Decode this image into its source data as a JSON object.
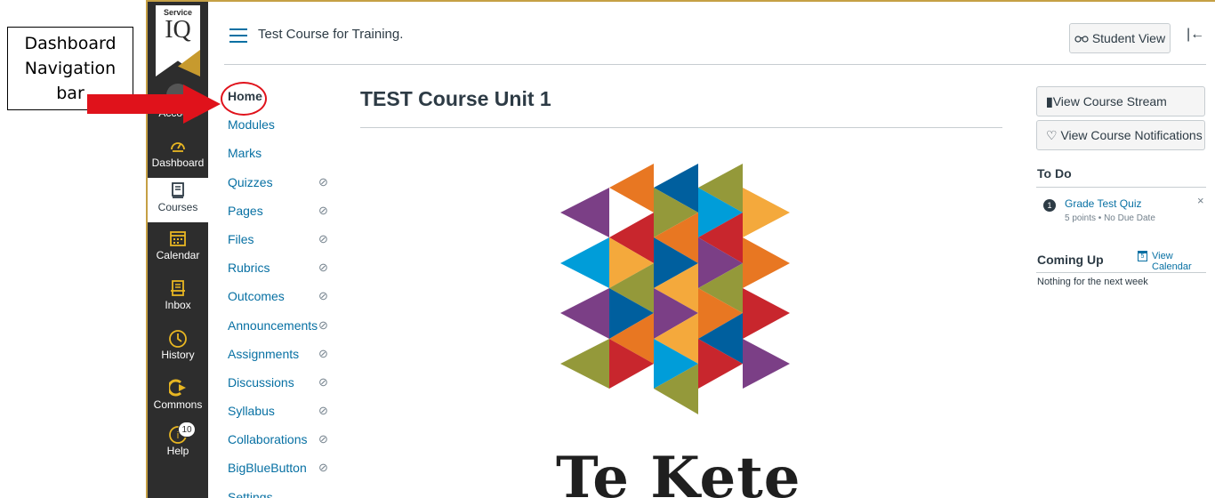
{
  "annotation": {
    "lines": [
      "Dashboard",
      "Navigation",
      "bar"
    ]
  },
  "global_nav": {
    "logo_top": "Service",
    "logo_main": "IQ",
    "items": [
      {
        "label": "Account",
        "icon": "account-avatar"
      },
      {
        "label": "Dashboard",
        "icon": "dashboard-icon"
      },
      {
        "label": "Courses",
        "icon": "courses-icon"
      },
      {
        "label": "Calendar",
        "icon": "calendar-icon"
      },
      {
        "label": "Inbox",
        "icon": "inbox-icon"
      },
      {
        "label": "History",
        "icon": "history-icon"
      },
      {
        "label": "Commons",
        "icon": "commons-icon"
      },
      {
        "label": "Help",
        "icon": "help-icon",
        "badge": "10"
      }
    ],
    "active": "Courses"
  },
  "header": {
    "course_title": "Test Course for Training.",
    "student_view": "Student View"
  },
  "course_nav": {
    "items": [
      {
        "label": "Home",
        "hidden": false
      },
      {
        "label": "Modules",
        "hidden": false
      },
      {
        "label": "Marks",
        "hidden": false
      },
      {
        "label": "Quizzes",
        "hidden": true
      },
      {
        "label": "Pages",
        "hidden": true
      },
      {
        "label": "Files",
        "hidden": true
      },
      {
        "label": "Rubrics",
        "hidden": true
      },
      {
        "label": "Outcomes",
        "hidden": true
      },
      {
        "label": "Announcements",
        "hidden": true
      },
      {
        "label": "Assignments",
        "hidden": true
      },
      {
        "label": "Discussions",
        "hidden": true
      },
      {
        "label": "Syllabus",
        "hidden": true
      },
      {
        "label": "Collaborations",
        "hidden": true
      },
      {
        "label": "BigBlueButton",
        "hidden": true
      },
      {
        "label": "Settings",
        "hidden": false
      }
    ]
  },
  "main": {
    "title": "TEST Course Unit 1",
    "logo_text": "Te Kete"
  },
  "sidebar": {
    "view_stream": "View Course Stream",
    "view_notifications": "View Course Notifications",
    "todo_heading": "To Do",
    "todo_items": [
      {
        "number": "1",
        "title": "Grade Test Quiz",
        "meta": "5 points • No Due Date"
      }
    ],
    "coming_up_heading": "Coming Up",
    "view_calendar": "View Calendar",
    "calendar_icon_day": "5",
    "nothing_text": "Nothing for the next week"
  },
  "colors": {
    "link": "#0770a3",
    "nav_bg": "#2d2d2d",
    "nav_icon": "#e8b622",
    "brand_gold": "#c5a045",
    "annotation_red": "#e0121b"
  }
}
